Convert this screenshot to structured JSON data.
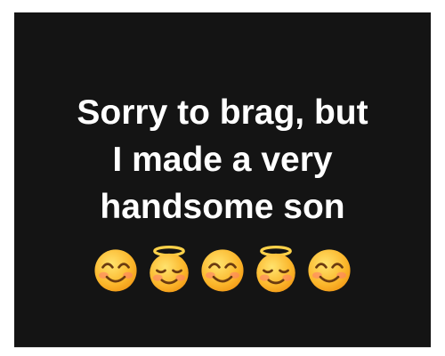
{
  "post": {
    "background_color": "#141414",
    "text_color": "#ffffff",
    "lines": [
      "Sorry to brag, but",
      "I made a very",
      "handsome son"
    ],
    "emojis": [
      "smiling-face-with-smiling-eyes-icon",
      "smiling-face-with-halo-icon",
      "smiling-face-with-smiling-eyes-icon",
      "smiling-face-with-halo-icon",
      "smiling-face-with-smiling-eyes-icon"
    ]
  }
}
